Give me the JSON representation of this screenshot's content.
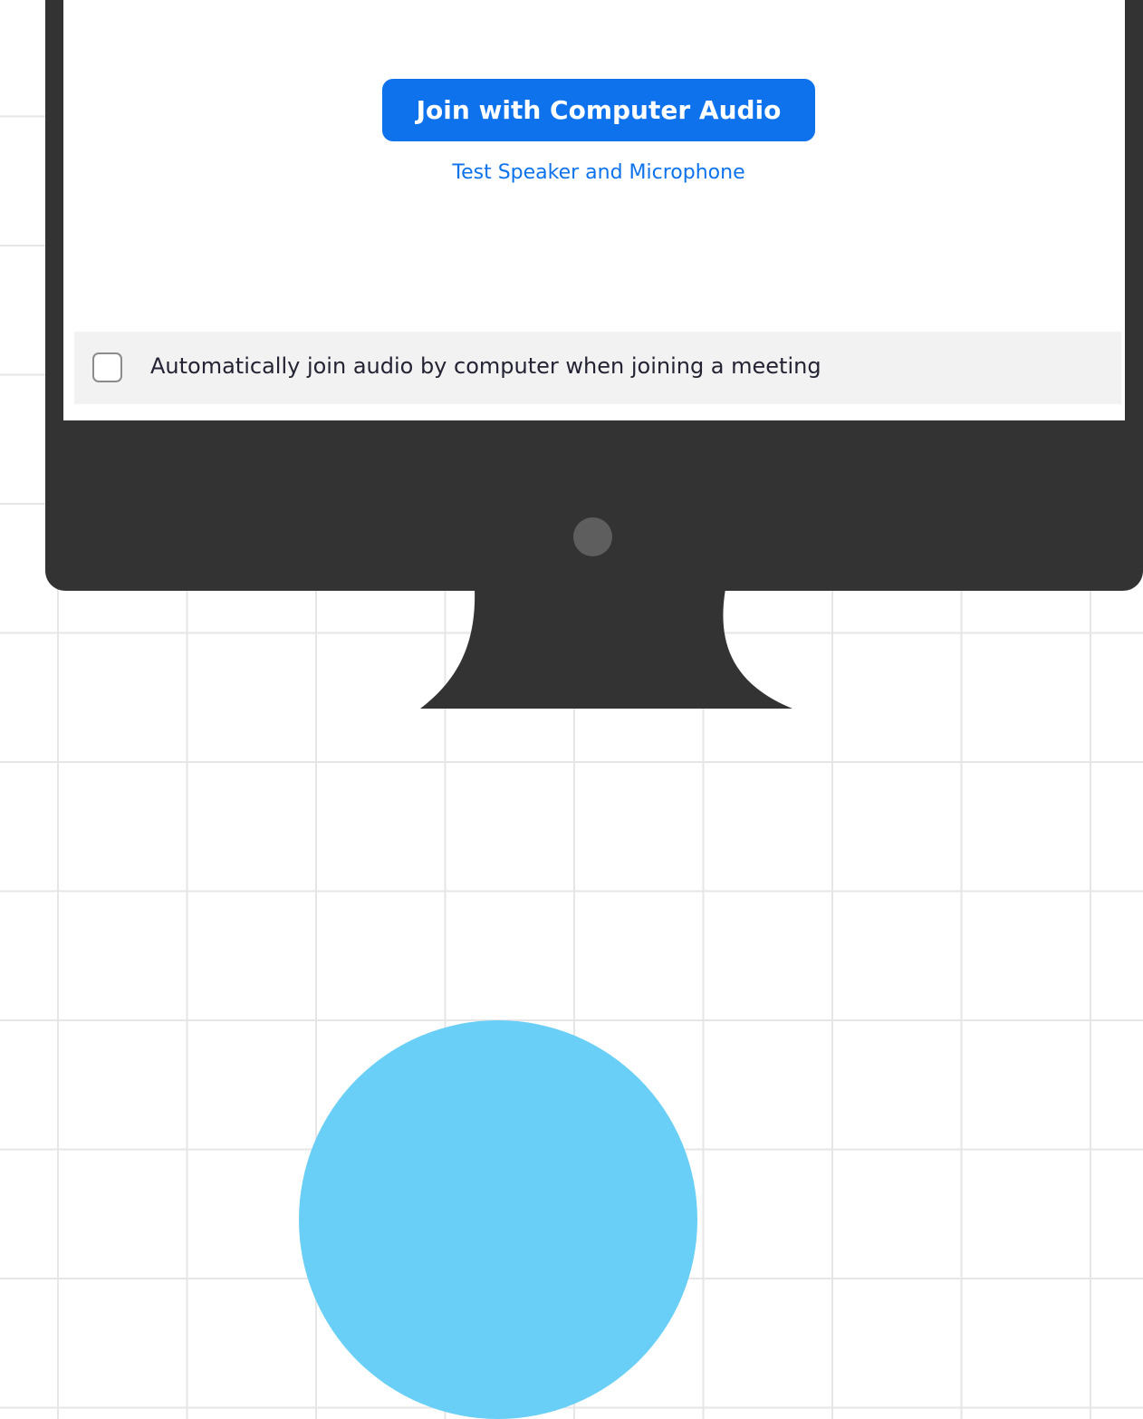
{
  "dialog": {
    "join_button_label": "Join with Computer Audio",
    "test_link_label": "Test Speaker and Microphone",
    "auto_join_label": "Automatically join audio by computer when joining a meeting",
    "auto_join_checked": false
  },
  "colors": {
    "accent": "#0e72ed",
    "monitor_body": "#333333",
    "grid_line": "#e6e6e6",
    "decor_circle": "#6acff6"
  }
}
